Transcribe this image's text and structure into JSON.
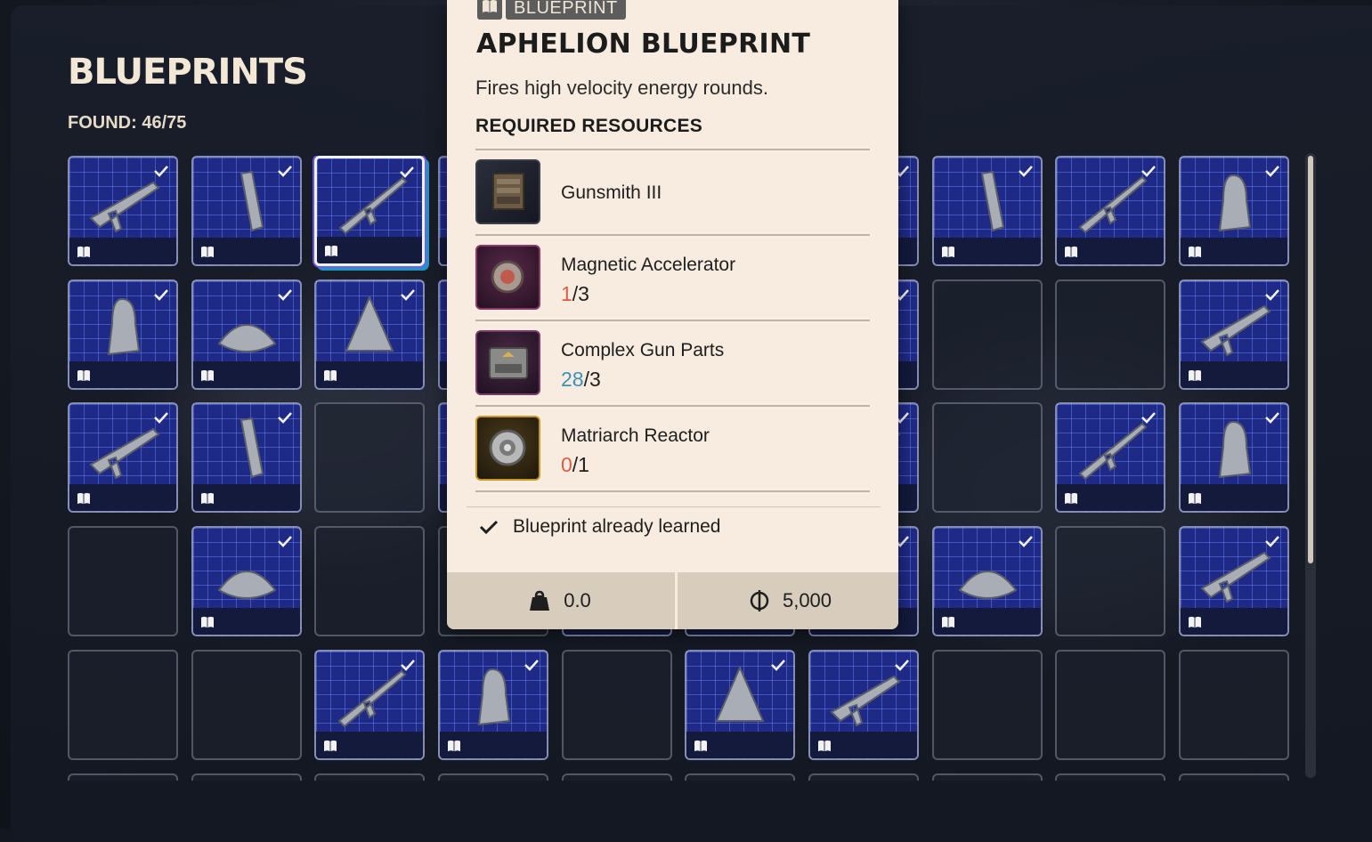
{
  "screen": {
    "title": "BLUEPRINTS",
    "found": "FOUND: 46/75"
  },
  "tooltip": {
    "tag": "BLUEPRINT",
    "title": "APHELION BLUEPRINT",
    "description": "Fires high velocity energy rounds.",
    "required_heading": "REQUIRED RESOURCES",
    "resources": [
      {
        "name": "Gunsmith III",
        "have": "",
        "need": "",
        "have_color": ""
      },
      {
        "name": "Magnetic Accelerator",
        "have": "1",
        "need": "/3",
        "have_color": "#e05a45"
      },
      {
        "name": "Complex Gun Parts",
        "have": "28",
        "need": "/3",
        "have_color": "#3e8fb6"
      },
      {
        "name": "Matriarch Reactor",
        "have": "0",
        "need": "/1",
        "have_color": "#e05a45"
      }
    ],
    "learned": "Blueprint already learned",
    "weight": "0.0",
    "price": "5,000"
  },
  "colors": {
    "accent_cream": "#f8ece0",
    "footer_tan": "#d8ccbd",
    "grid_blue": "#1f2a86",
    "deficit_red": "#e05a45",
    "surplus_blue": "#3e8fb6"
  },
  "icons": {
    "book": "book-icon",
    "check": "check-icon",
    "weight": "weight-icon",
    "currency": "coin-icon"
  }
}
